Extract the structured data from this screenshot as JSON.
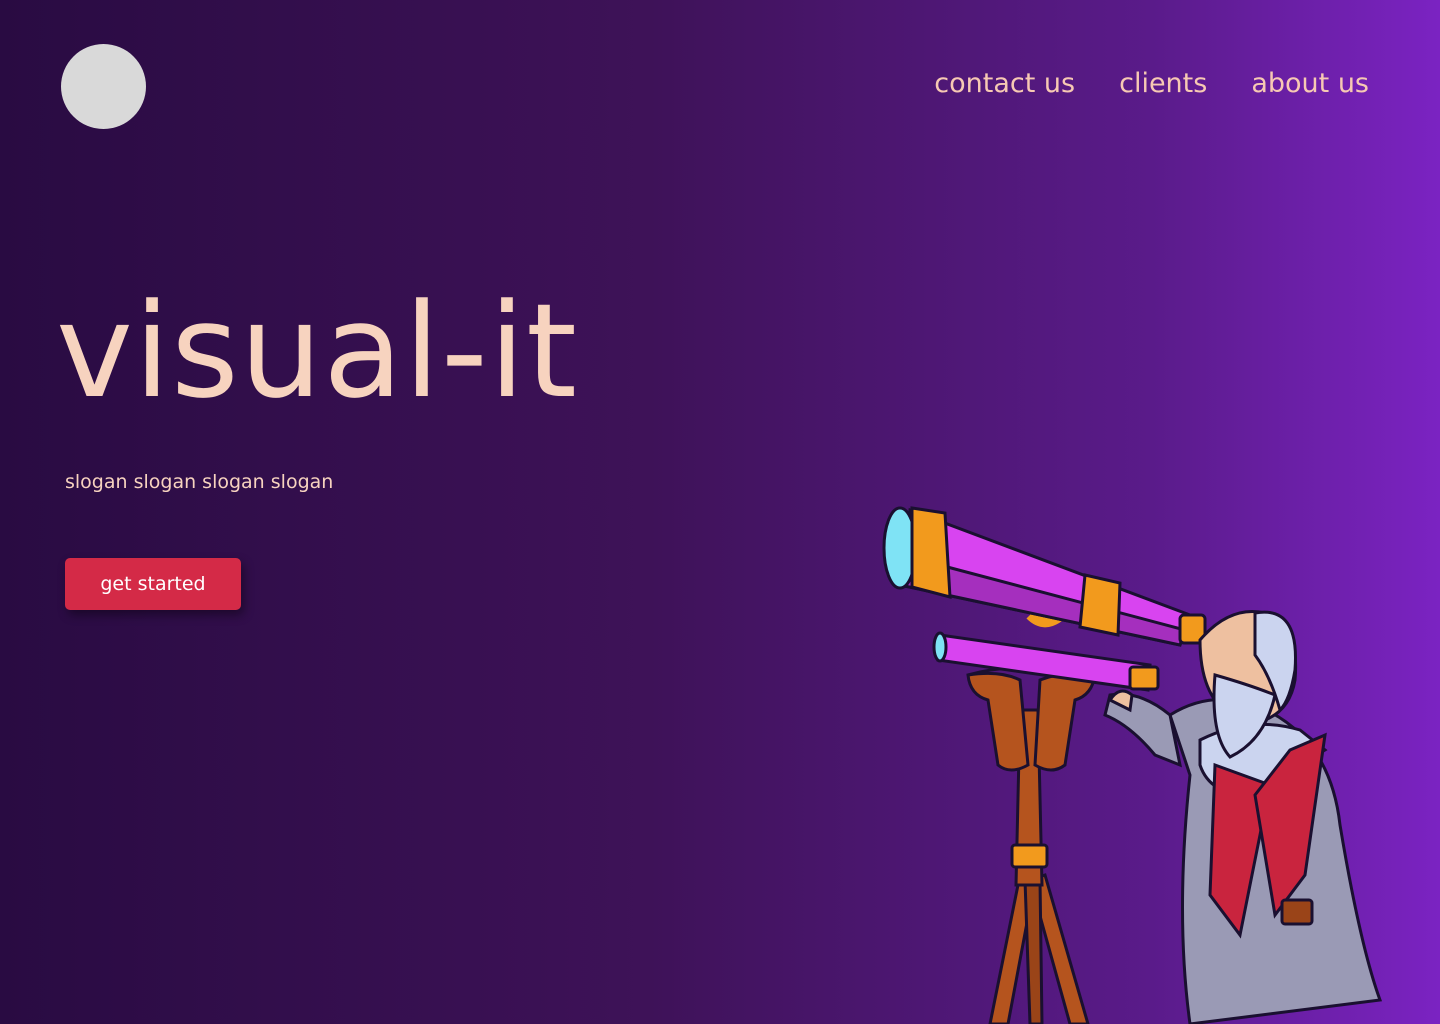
{
  "header": {
    "logo_icon": "circle-logo",
    "nav": [
      {
        "label": "contact us"
      },
      {
        "label": "clients"
      },
      {
        "label": "about us"
      }
    ]
  },
  "hero": {
    "title": "visual-it",
    "slogan": "slogan slogan slogan slogan",
    "cta_label": "get started"
  },
  "illustration": {
    "subject": "astronomer-with-telescope"
  },
  "colors": {
    "background_start": "#290b42",
    "background_end": "#7b23c2",
    "text_accent": "#f7d3bf",
    "button": "#d42a47",
    "button_text": "#ffffff",
    "logo": "#d9d9d9"
  }
}
